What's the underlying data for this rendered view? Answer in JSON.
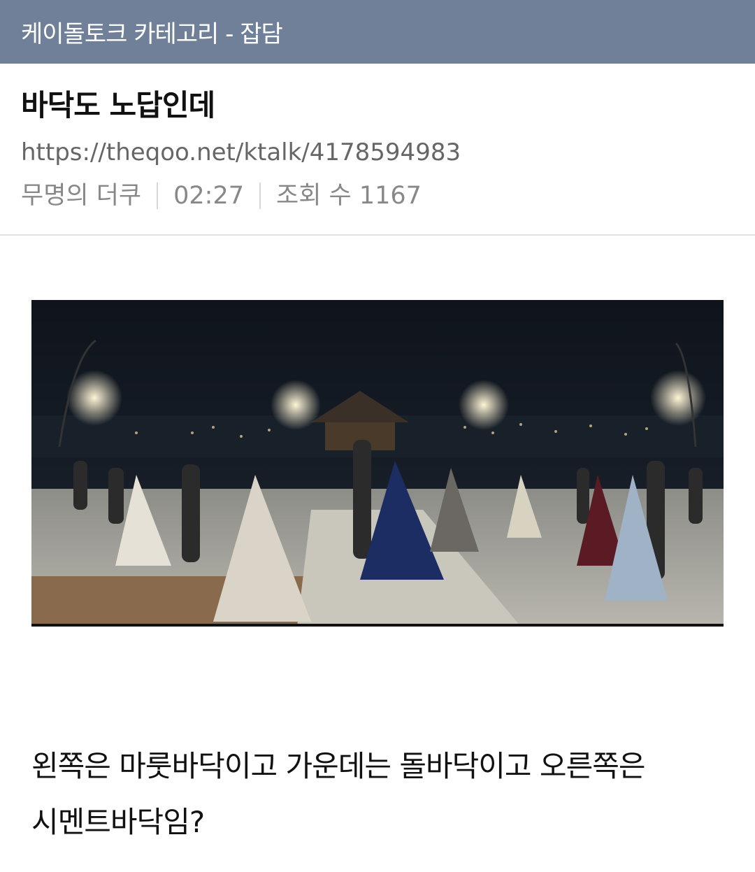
{
  "category_bar": {
    "text": "케이돌토크 카테고리 - 잡담"
  },
  "post": {
    "title": "바닥도 노답인데",
    "url": "https://theqoo.net/ktalk/4178594983",
    "author": "무명의 더쿠",
    "time": "02:27",
    "views": "조회 수 1167",
    "body_line1": "왼쪽은 마룻바닥이고 가운데는 돌바닥이고 오른쪽은",
    "body_line2": "시멘트바닥임?"
  }
}
